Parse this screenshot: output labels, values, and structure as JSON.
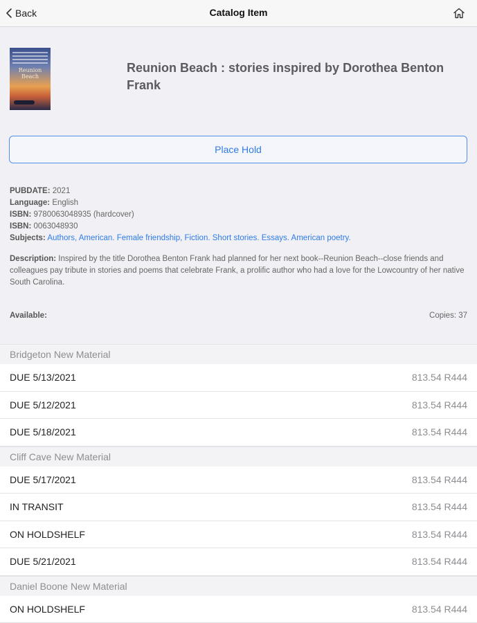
{
  "nav": {
    "back_label": "Back",
    "title": "Catalog Item"
  },
  "book": {
    "title": "Reunion Beach : stories inspired by Dorothea Benton Frank",
    "cover_text": "Reunion Beach"
  },
  "actions": {
    "place_hold": "Place Hold"
  },
  "meta": {
    "pubdate_label": "PUBDATE:",
    "pubdate": "2021",
    "language_label": "Language:",
    "language": "English",
    "isbn_label": "ISBN:",
    "isbn1": "9780063048935 (hardcover)",
    "isbn2": "0063048930",
    "subjects_label": "Subjects:",
    "subjects": [
      "Authors, American.",
      "Female friendship, Fiction.",
      "Short stories.",
      "Essays.",
      "American poetry."
    ]
  },
  "description": {
    "label": "Description:",
    "text": "Inspired by the title Dorothea Benton Frank had planned for her next book--Reunion Beach--close friends and colleagues pay tribute in stories and poems that celebrate Frank, a prolific author who had a love for the Lowcountry of her native South Carolina."
  },
  "availability": {
    "label": "Available:",
    "copies": "Copies: 37"
  },
  "holdings": [
    {
      "library": "Bridgeton New Material",
      "items": [
        {
          "status": "DUE 5/13/2021",
          "call_number": "813.54 R444"
        },
        {
          "status": "DUE 5/12/2021",
          "call_number": "813.54 R444"
        },
        {
          "status": "DUE 5/18/2021",
          "call_number": "813.54 R444"
        }
      ]
    },
    {
      "library": "Cliff Cave New Material",
      "items": [
        {
          "status": "DUE 5/17/2021",
          "call_number": "813.54 R444"
        },
        {
          "status": "IN TRANSIT",
          "call_number": "813.54 R444"
        },
        {
          "status": "ON HOLDSHELF",
          "call_number": "813.54 R444"
        },
        {
          "status": "DUE 5/21/2021",
          "call_number": "813.54 R444"
        }
      ]
    },
    {
      "library": "Daniel Boone New Material",
      "items": [
        {
          "status": "ON HOLDSHELF",
          "call_number": "813.54 R444"
        }
      ]
    }
  ],
  "colors": {
    "accent": "#2f7bea",
    "background": "#f0f0f5"
  },
  "icons": {
    "back": "chevron-left-icon",
    "home": "home-icon"
  }
}
